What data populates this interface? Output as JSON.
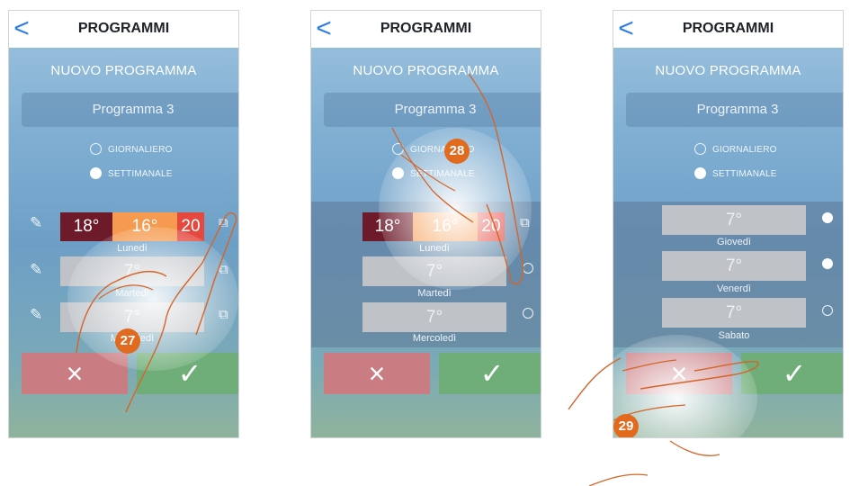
{
  "header": {
    "title": "PROGRAMMI",
    "back_glyph": "<"
  },
  "subtitle": "NUOVO PROGRAMMA",
  "program_name": "Programma 3",
  "options": {
    "daily": "GIORNALIERO",
    "weekly": "SETTIMANALE",
    "selected": "SETTIMANALE"
  },
  "days": {
    "mon": "Lunedì",
    "tue": "Martedì",
    "wed": "Mercoledì",
    "thu": "Giovedì",
    "fri": "Venerdì",
    "sat": "Sabato"
  },
  "temps": {
    "t1": "18°",
    "t2": "16°",
    "t3": "20",
    "default": "7°"
  },
  "colors": {
    "dark_red": "#6d1a2a",
    "orange": "#f59a4e",
    "red": "#e4483f",
    "accent": "#2d7fe0",
    "badge": "#e26a1f",
    "cancel": "#c97d83",
    "confirm": "#6fae78"
  },
  "buttons": {
    "cancel_glyph": "×",
    "confirm_glyph": "✓"
  },
  "steps": {
    "s1": "27",
    "s2": "28",
    "s3": "29"
  },
  "screen3_selection": {
    "thu": true,
    "fri": true,
    "sat": false
  }
}
